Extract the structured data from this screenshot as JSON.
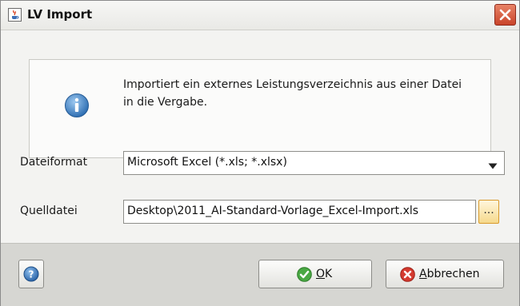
{
  "window": {
    "title": "LV Import"
  },
  "info": {
    "text": "Importiert ein externes Leistungsverzeichnis aus einer Datei in die Vergabe."
  },
  "form": {
    "dateiformat_label": "Dateiformat",
    "dateiformat_value": "Microsoft Excel (*.xls; *.xlsx)",
    "quelldatei_label": "Quelldatei",
    "quelldatei_value": "Desktop\\2011_AI-Standard-Vorlage_Excel-Import.xls",
    "browse_label": "..."
  },
  "footer": {
    "ok_accel": "O",
    "ok_rest": "K",
    "cancel_accel": "A",
    "cancel_rest": "bbrechen"
  },
  "icons": {
    "app": "java-cup-icon",
    "close": "close-icon",
    "info": "info-icon",
    "dropdown": "chevron-down-icon",
    "help": "help-icon",
    "ok": "checkmark-icon",
    "cancel": "cancel-icon"
  },
  "colors": {
    "close_button": "#d4563b",
    "info_icon": "#3a7fc4",
    "ok_icon": "#3ea33b",
    "cancel_icon": "#d23a2e",
    "browse_button": "#f6d98c",
    "footer_bg": "#d6d6d2"
  }
}
